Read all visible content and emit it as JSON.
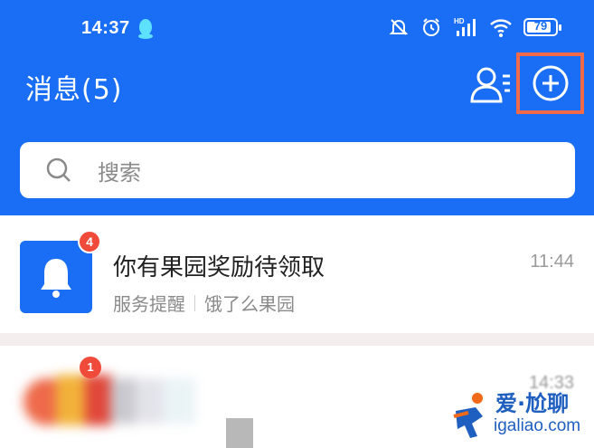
{
  "status_bar": {
    "time": "14:37",
    "battery": "79",
    "network_badge": "HD"
  },
  "header": {
    "title": "消息(5)"
  },
  "search": {
    "placeholder": "搜索"
  },
  "conversations": [
    {
      "title": "你有果园奖励待领取",
      "source": "服务提醒",
      "sender": "饿了么果园",
      "time": "11:44",
      "unread": "4"
    },
    {
      "time": "14:33",
      "unread": "1"
    }
  ],
  "watermark": {
    "line1": "爱·尬聊",
    "line2": "igaliao.com"
  },
  "colors": {
    "header_bg": "#1a6ef5",
    "highlight_border": "#f06a4a",
    "badge": "#f04a3a"
  }
}
